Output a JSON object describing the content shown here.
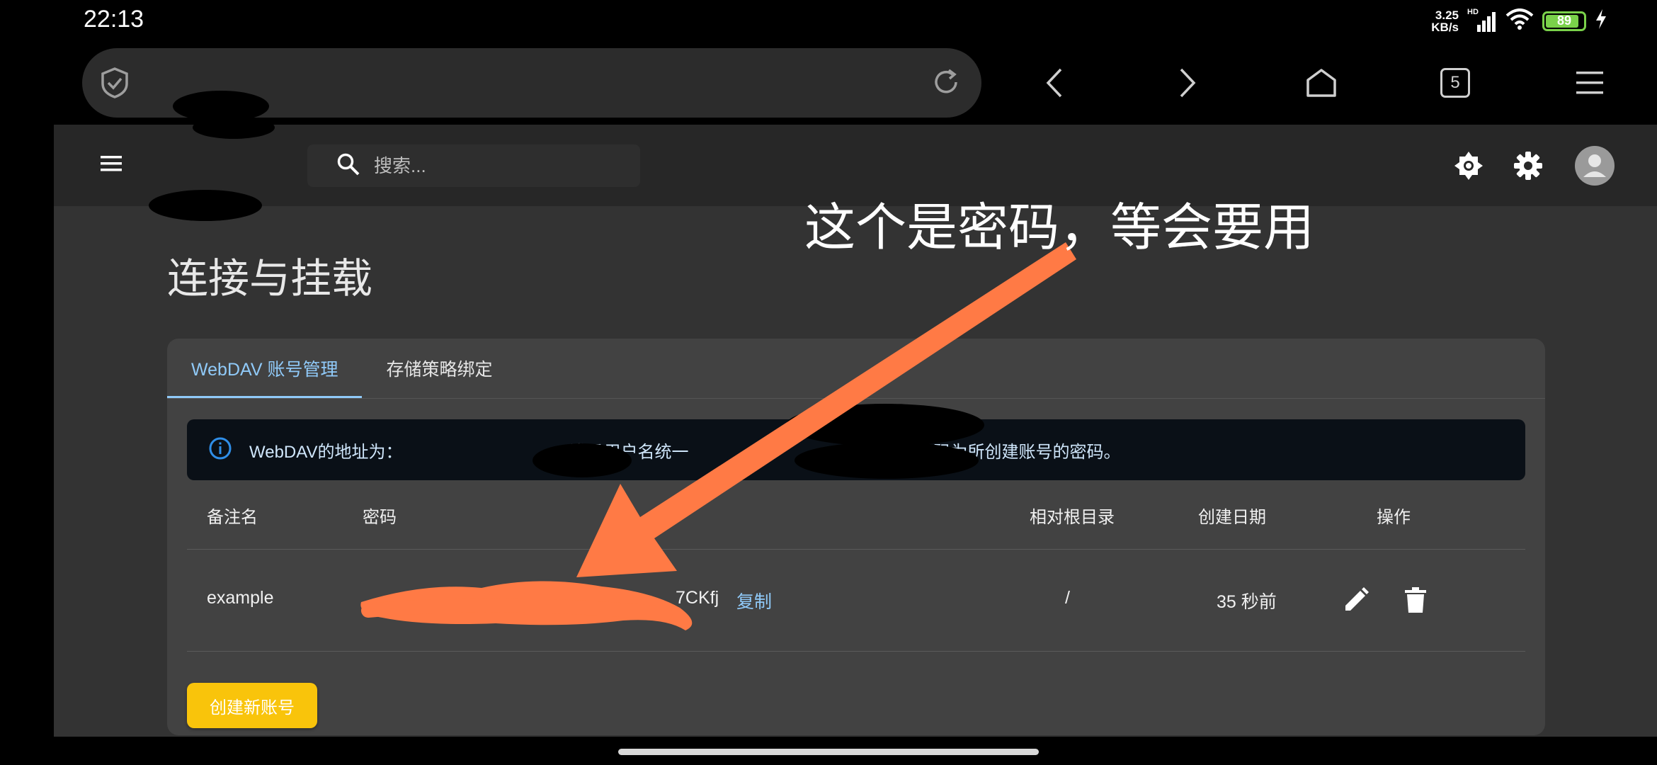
{
  "status_bar": {
    "time": "22:13",
    "net_speed_value": "3.25",
    "net_speed_unit": "KB/s",
    "signal_badge": "HD",
    "battery_level": "89",
    "battery_fraction": 0.89,
    "icons": [
      "signal-icon",
      "wifi-icon",
      "battery-icon",
      "charging-icon"
    ]
  },
  "browser": {
    "url": "",
    "tab_count": "5",
    "icons": [
      "shield-check-icon",
      "reload-icon",
      "back-icon",
      "forward-icon",
      "home-icon",
      "tabs-icon",
      "menu-icon"
    ]
  },
  "app_bar": {
    "search_placeholder": "搜索...",
    "icons": [
      "menu-icon",
      "search-icon",
      "theme-brightness-icon",
      "settings-icon",
      "avatar-icon"
    ]
  },
  "page": {
    "title": "连接与挂载",
    "tabs": [
      {
        "label": "WebDAV 账号管理",
        "active": true
      },
      {
        "label": "存储策略绑定",
        "active": false
      }
    ],
    "alert": {
      "text_start": "WebDAV的地址为：",
      "text_middle": "登录用户名统一",
      "text_end": "码为所创建账号的密码。"
    },
    "table": {
      "headers": [
        "备注名",
        "密码",
        "相对根目录",
        "创建日期",
        "操作"
      ],
      "rows": [
        {
          "name": "example",
          "password_visible": "7CKfj",
          "copy_label": "复制",
          "root": "/",
          "created": "35 秒前"
        }
      ]
    },
    "create_button": "创建新账号"
  },
  "annotation": {
    "text": "这个是密码，等会要用",
    "color": "#ff7a45"
  },
  "colors": {
    "accent_blue": "#90caf9",
    "create_button": "#f9c40b",
    "battery_green": "#7ad14a"
  }
}
